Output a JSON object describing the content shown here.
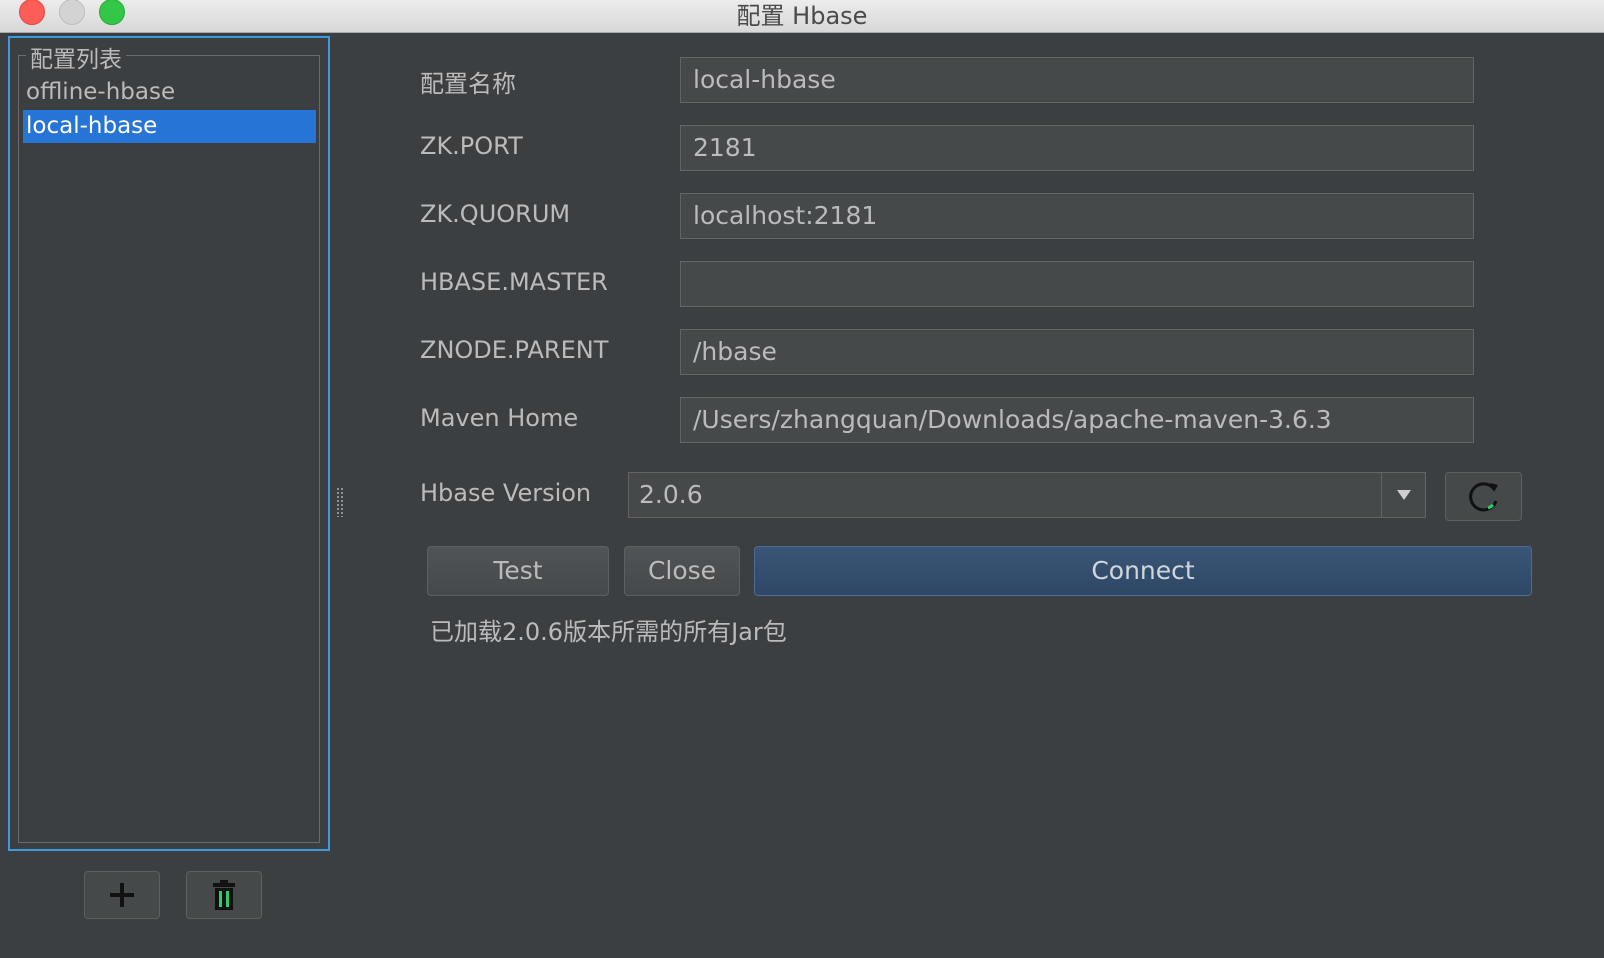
{
  "window": {
    "title": "配置 Hbase"
  },
  "sidebar": {
    "group_title": "配置列表",
    "items": [
      {
        "label": "offline-hbase",
        "selected": false
      },
      {
        "label": "local-hbase",
        "selected": true
      }
    ],
    "add_icon": "plus-icon",
    "delete_icon": "trash-icon"
  },
  "form": {
    "config_name_label": "配置名称",
    "config_name_value": "local-hbase",
    "zk_port_label": "ZK.PORT",
    "zk_port_value": "2181",
    "zk_quorum_label": "ZK.QUORUM",
    "zk_quorum_value": "localhost:2181",
    "hbase_master_label": "HBASE.MASTER",
    "hbase_master_value": "",
    "znode_parent_label": "ZNODE.PARENT",
    "znode_parent_value": "/hbase",
    "maven_home_label": "Maven Home",
    "maven_home_value": "/Users/zhangquan/Downloads/apache-maven-3.6.3",
    "hbase_version_label": "Hbase Version",
    "hbase_version_value": "2.0.6"
  },
  "buttons": {
    "test": "Test",
    "close": "Close",
    "connect": "Connect"
  },
  "status": {
    "message": "已加载2.0.6版本所需的所有Jar包"
  },
  "colors": {
    "background": "#3c3f41",
    "selection": "#2675d6",
    "focus_border": "#3d9bdd",
    "primary_button": "#2e4765"
  }
}
